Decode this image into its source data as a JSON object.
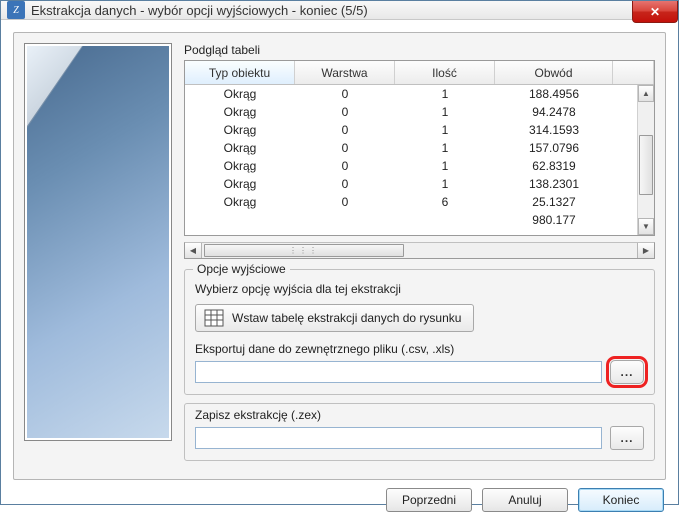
{
  "window": {
    "title": "Ekstrakcja danych - wybór opcji wyjściowych - koniec (5/5)"
  },
  "preview_label": "Podgląd tabeli",
  "table": {
    "headers": [
      "Typ obiektu",
      "Warstwa",
      "Ilość",
      "Obwód"
    ],
    "rows": [
      [
        "Okrąg",
        "0",
        "1",
        "188.4956"
      ],
      [
        "Okrąg",
        "0",
        "1",
        "94.2478"
      ],
      [
        "Okrąg",
        "0",
        "1",
        "314.1593"
      ],
      [
        "Okrąg",
        "0",
        "1",
        "157.0796"
      ],
      [
        "Okrąg",
        "0",
        "1",
        "62.8319"
      ],
      [
        "Okrąg",
        "0",
        "1",
        "138.2301"
      ],
      [
        "Okrąg",
        "0",
        "6",
        "25.1327"
      ],
      [
        "",
        "",
        "",
        "980.177"
      ]
    ]
  },
  "output": {
    "group_label": "Opcje wyjściowe",
    "choose_label": "Wybierz opcję wyjścia dla tej ekstrakcji",
    "insert_label": "Wstaw tabelę ekstrakcji danych do rysunku",
    "export_label": "Eksportuj dane do zewnętrznego pliku (.csv, .xls)",
    "export_value": "",
    "browse_label": "..."
  },
  "save": {
    "label": "Zapisz ekstrakcję (.zex)",
    "value": "",
    "browse_label": "..."
  },
  "buttons": {
    "prev": "Poprzedni",
    "cancel": "Anuluj",
    "finish": "Koniec"
  }
}
